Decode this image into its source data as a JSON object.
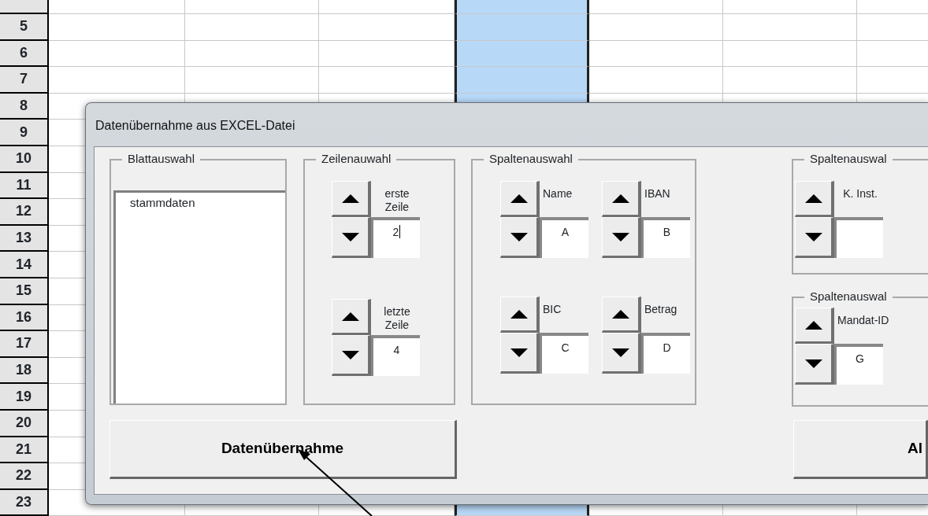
{
  "spreadsheet": {
    "columns": [
      {
        "selected": false
      },
      {
        "selected": false
      },
      {
        "selected": false
      },
      {
        "selected": true
      },
      {
        "selected": false
      },
      {
        "selected": false
      },
      {
        "selected": false
      }
    ],
    "rows": [
      {
        "header": "5"
      },
      {
        "header": "6"
      },
      {
        "header": "7"
      },
      {
        "header": "8"
      },
      {
        "header": "9"
      },
      {
        "header": "10"
      },
      {
        "header": "11"
      },
      {
        "header": "12"
      },
      {
        "header": "13"
      },
      {
        "header": "14"
      },
      {
        "header": "15"
      },
      {
        "header": "16"
      },
      {
        "header": "17"
      },
      {
        "header": "18"
      },
      {
        "header": "19"
      },
      {
        "header": "20"
      },
      {
        "header": "21"
      },
      {
        "header": "22"
      },
      {
        "header": "23"
      }
    ]
  },
  "dialog": {
    "title": "Datenübernahme aus EXCEL-Datei",
    "sheet_group": {
      "legend": "Blattauswahl",
      "items": [
        {
          "label": "stammdaten",
          "selected": false
        }
      ]
    },
    "row_group": {
      "legend": "Zeilenauwahl",
      "spinners": [
        {
          "label": "erste Zeile",
          "value": "2",
          "focused": true
        },
        {
          "label": "letzte Zeile",
          "value": "4",
          "focused": false
        }
      ]
    },
    "column_group": {
      "legend": "Spaltenauswahl",
      "spinners": [
        {
          "label": "Name",
          "value": "A",
          "focused": false
        },
        {
          "label": "IBAN",
          "value": "B",
          "focused": false
        },
        {
          "label": "BIC",
          "value": "C",
          "focused": false
        },
        {
          "label": "Betrag",
          "value": "D",
          "focused": false
        }
      ]
    },
    "side_groups": [
      {
        "legend": "Spaltenauswal",
        "spinners": [
          {
            "label": "K. Inst.",
            "focused": false
          }
        ]
      },
      {
        "legend": "Spaltenauswal",
        "spinners": [
          {
            "label": "Mandat-ID",
            "value": "G",
            "focused": false
          }
        ]
      }
    ],
    "buttons": [
      {
        "label": "Datenübernahme"
      },
      {
        "label": "Al"
      }
    ]
  }
}
